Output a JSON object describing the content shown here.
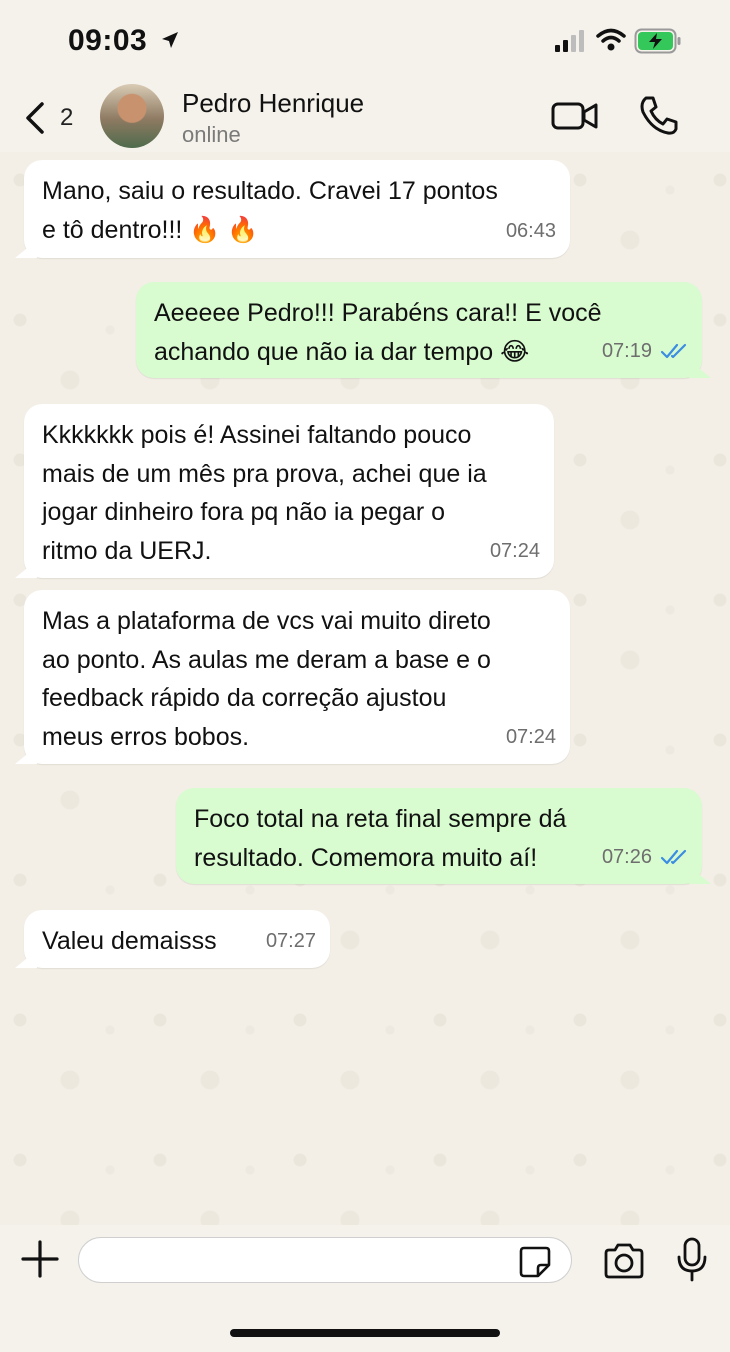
{
  "status_bar": {
    "time": "09:03"
  },
  "header": {
    "back_count": "2",
    "contact_name": "Pedro Henrique",
    "contact_status": "online"
  },
  "messages": [
    {
      "direction": "in",
      "text": "Mano, saiu o resultado. Cravei 17 pontos\ne tô dentro!!! 🔥 🔥",
      "time": "06:43"
    },
    {
      "direction": "out",
      "text": "Aeeeee Pedro!!! Parabéns cara!! E você\nachando que não ia dar tempo 😂",
      "time": "07:19",
      "read": true
    },
    {
      "direction": "in",
      "text": "Kkkkkkk pois é! Assinei faltando pouco\nmais de um mês pra prova, achei que ia\njogar dinheiro fora pq não ia pegar o\nritmo da UERJ.",
      "time": "07:24"
    },
    {
      "direction": "in",
      "text": "Mas a plataforma de vcs vai muito direto\nao ponto. As aulas me deram a base e o\nfeedback rápido da correção ajustou\nmeus erros bobos.",
      "time": "07:24"
    },
    {
      "direction": "out",
      "text": "Foco total na reta final sempre dá\nresultado. Comemora muito aí!",
      "time": "07:26",
      "read": true
    },
    {
      "direction": "in",
      "text": "Valeu demaisss",
      "time": "07:27"
    }
  ],
  "composer": {
    "placeholder": ""
  },
  "icons": {
    "back": "chevron-left-icon",
    "video": "video-camera-icon",
    "phone": "phone-icon",
    "plus": "plus-icon",
    "sticker": "sticker-icon",
    "camera": "camera-icon",
    "mic": "microphone-icon",
    "read_ticks": "double-check-icon"
  },
  "colors": {
    "incoming_bubble": "#ffffff",
    "outgoing_bubble": "#d8fbd0",
    "read_ticks": "#3b8de3",
    "battery_fill": "#34c759"
  }
}
